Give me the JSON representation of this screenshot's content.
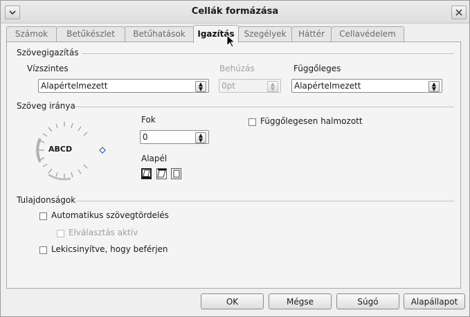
{
  "window": {
    "title": "Cellák formázása"
  },
  "tabs": [
    {
      "label": "Számok"
    },
    {
      "label": "Betűkészlet"
    },
    {
      "label": "Betűhatások"
    },
    {
      "label": "Igazítás"
    },
    {
      "label": "Szegélyek"
    },
    {
      "label": "Háttér"
    },
    {
      "label": "Cellavédelem"
    }
  ],
  "active_tab": "Igazítás",
  "text_alignment": {
    "heading": "Szövegigazítás",
    "horizontal_label": "Vízszintes",
    "horizontal_value": "Alapértelmezett",
    "indent_label": "Behúzás",
    "indent_value": "0pt",
    "vertical_label": "Függőleges",
    "vertical_value": "Alapértelmezett"
  },
  "text_direction": {
    "heading": "Szöveg iránya",
    "dial_text": "ABCD",
    "degrees_label": "Fok",
    "degrees_value": "0",
    "reference_edge_label": "Alapél",
    "vertically_stacked_label": "Függőlegesen halmozott"
  },
  "properties": {
    "heading": "Tulajdonságok",
    "wrap_text_label": "Automatikus szövegtördelés",
    "hyphenation_label": "Elválasztás aktív",
    "shrink_to_fit_label": "Lekicsinyítve, hogy beférjen"
  },
  "buttons": {
    "ok": "OK",
    "cancel": "Mégse",
    "help": "Súgó",
    "reset": "Alapállapot"
  },
  "icons": {
    "window_menu": "chevron-down-icon",
    "close": "close-icon"
  }
}
